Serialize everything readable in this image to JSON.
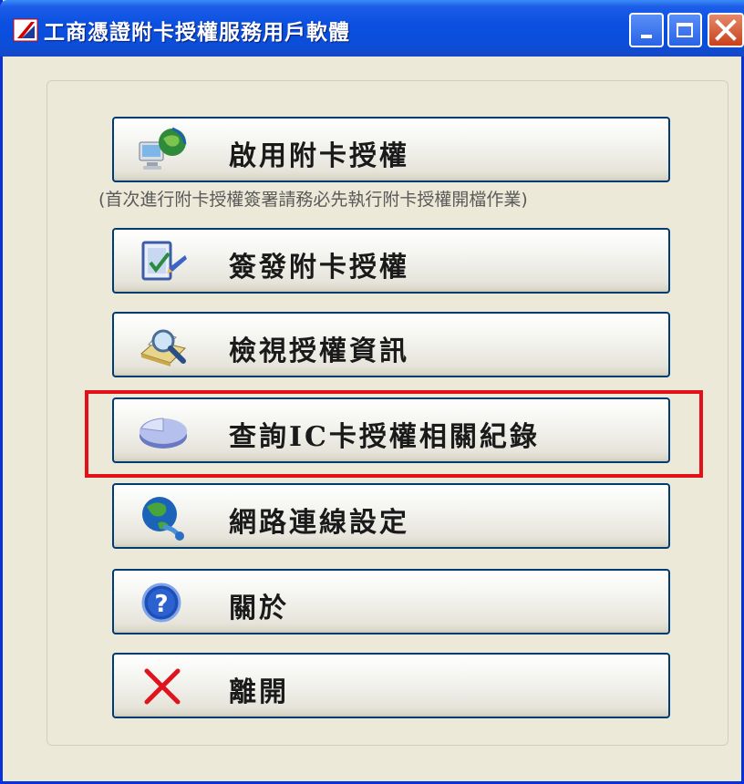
{
  "window": {
    "title": "工商憑證附卡授權服務用戶軟體",
    "controls": [
      "minimize",
      "maximize",
      "close"
    ]
  },
  "menu": {
    "hint": "(首次進行附卡授權簽署請務必先執行附卡授權開檔作業)",
    "buttons": [
      {
        "id": "enable",
        "label": "啟用附卡授權",
        "icon": "network-computer-globe-icon"
      },
      {
        "id": "issue",
        "label": "簽發附卡授權",
        "icon": "document-sign-icon"
      },
      {
        "id": "view",
        "label": "檢視授權資訊",
        "icon": "magnifier-document-icon"
      },
      {
        "id": "query",
        "label": "查詢IC卡授權相關紀錄",
        "icon": "pie-chart-icon",
        "highlighted": true
      },
      {
        "id": "network",
        "label": "網路連線設定",
        "icon": "globe-network-icon"
      },
      {
        "id": "about",
        "label": "關於",
        "icon": "help-icon"
      },
      {
        "id": "exit",
        "label": "離開",
        "icon": "close-x-icon"
      }
    ]
  },
  "colors": {
    "titlebar": "#0A4FE0",
    "highlight": "#E3101A",
    "face": "#ECE9D8"
  }
}
